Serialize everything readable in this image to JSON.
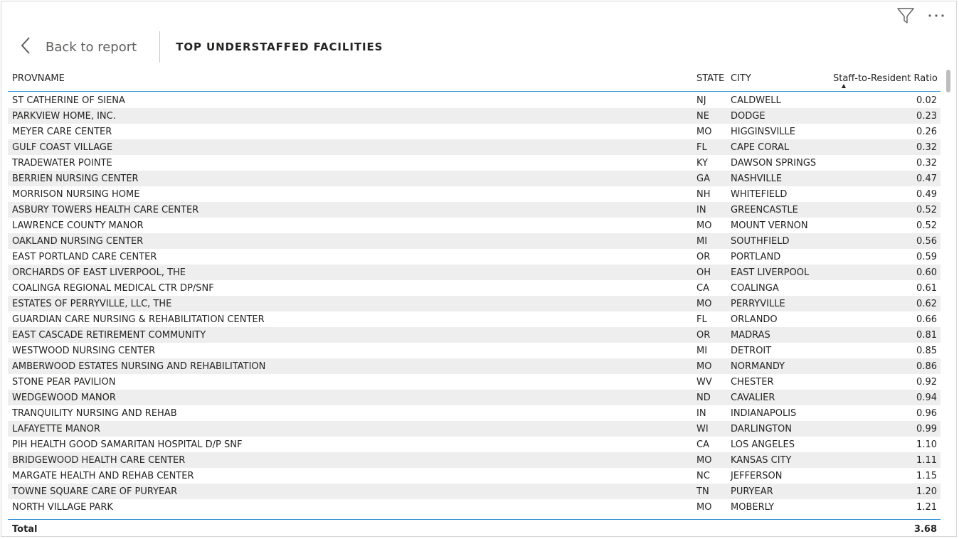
{
  "toolbar": {
    "filter_icon": "filter-icon",
    "more_label": "···"
  },
  "header": {
    "back_label": "Back to report",
    "title": "TOP UNDERSTAFFED FACILITIES"
  },
  "columns": {
    "name": "PROVNAME",
    "state": "STATE",
    "city": "CITY",
    "ratio": "Staff-to-Resident Ratio",
    "sort": "▲"
  },
  "rows": [
    {
      "name": "ST CATHERINE OF SIENA",
      "state": "NJ",
      "city": "CALDWELL",
      "ratio": "0.02"
    },
    {
      "name": "PARKVIEW HOME, INC.",
      "state": "NE",
      "city": "DODGE",
      "ratio": "0.23"
    },
    {
      "name": "MEYER CARE CENTER",
      "state": "MO",
      "city": "HIGGINSVILLE",
      "ratio": "0.26"
    },
    {
      "name": "GULF COAST VILLAGE",
      "state": "FL",
      "city": "CAPE CORAL",
      "ratio": "0.32"
    },
    {
      "name": "TRADEWATER POINTE",
      "state": "KY",
      "city": "DAWSON SPRINGS",
      "ratio": "0.32"
    },
    {
      "name": "BERRIEN NURSING CENTER",
      "state": "GA",
      "city": "NASHVILLE",
      "ratio": "0.47"
    },
    {
      "name": "MORRISON NURSING HOME",
      "state": "NH",
      "city": "WHITEFIELD",
      "ratio": "0.49"
    },
    {
      "name": "ASBURY TOWERS HEALTH CARE CENTER",
      "state": "IN",
      "city": "GREENCASTLE",
      "ratio": "0.52"
    },
    {
      "name": "LAWRENCE COUNTY MANOR",
      "state": "MO",
      "city": "MOUNT VERNON",
      "ratio": "0.52"
    },
    {
      "name": "OAKLAND NURSING CENTER",
      "state": "MI",
      "city": "SOUTHFIELD",
      "ratio": "0.56"
    },
    {
      "name": "EAST PORTLAND CARE CENTER",
      "state": "OR",
      "city": "PORTLAND",
      "ratio": "0.59"
    },
    {
      "name": "ORCHARDS OF EAST LIVERPOOL, THE",
      "state": "OH",
      "city": "EAST LIVERPOOL",
      "ratio": "0.60"
    },
    {
      "name": "COALINGA REGIONAL MEDICAL CTR DP/SNF",
      "state": "CA",
      "city": "COALINGA",
      "ratio": "0.61"
    },
    {
      "name": "ESTATES OF PERRYVILLE, LLC, THE",
      "state": "MO",
      "city": "PERRYVILLE",
      "ratio": "0.62"
    },
    {
      "name": "GUARDIAN CARE NURSING & REHABILITATION CENTER",
      "state": "FL",
      "city": "ORLANDO",
      "ratio": "0.66"
    },
    {
      "name": "EAST CASCADE RETIREMENT COMMUNITY",
      "state": "OR",
      "city": "MADRAS",
      "ratio": "0.81"
    },
    {
      "name": "WESTWOOD NURSING CENTER",
      "state": "MI",
      "city": "DETROIT",
      "ratio": "0.85"
    },
    {
      "name": "AMBERWOOD ESTATES NURSING AND REHABILITATION",
      "state": "MO",
      "city": "NORMANDY",
      "ratio": "0.86"
    },
    {
      "name": "STONE PEAR PAVILION",
      "state": "WV",
      "city": "CHESTER",
      "ratio": "0.92"
    },
    {
      "name": "WEDGEWOOD MANOR",
      "state": "ND",
      "city": "CAVALIER",
      "ratio": "0.94"
    },
    {
      "name": "TRANQUILITY NURSING AND REHAB",
      "state": "IN",
      "city": "INDIANAPOLIS",
      "ratio": "0.96"
    },
    {
      "name": "LAFAYETTE MANOR",
      "state": "WI",
      "city": "DARLINGTON",
      "ratio": "0.99"
    },
    {
      "name": "PIH HEALTH GOOD SAMARITAN HOSPITAL D/P SNF",
      "state": "CA",
      "city": "LOS ANGELES",
      "ratio": "1.10"
    },
    {
      "name": "BRIDGEWOOD HEALTH CARE CENTER",
      "state": "MO",
      "city": "KANSAS CITY",
      "ratio": "1.11"
    },
    {
      "name": "MARGATE HEALTH AND REHAB CENTER",
      "state": "NC",
      "city": "JEFFERSON",
      "ratio": "1.15"
    },
    {
      "name": "TOWNE SQUARE CARE OF PURYEAR",
      "state": "TN",
      "city": "PURYEAR",
      "ratio": "1.20"
    },
    {
      "name": "NORTH VILLAGE PARK",
      "state": "MO",
      "city": "MOBERLY",
      "ratio": "1.21"
    }
  ],
  "total": {
    "label": "Total",
    "ratio": "3.68"
  }
}
